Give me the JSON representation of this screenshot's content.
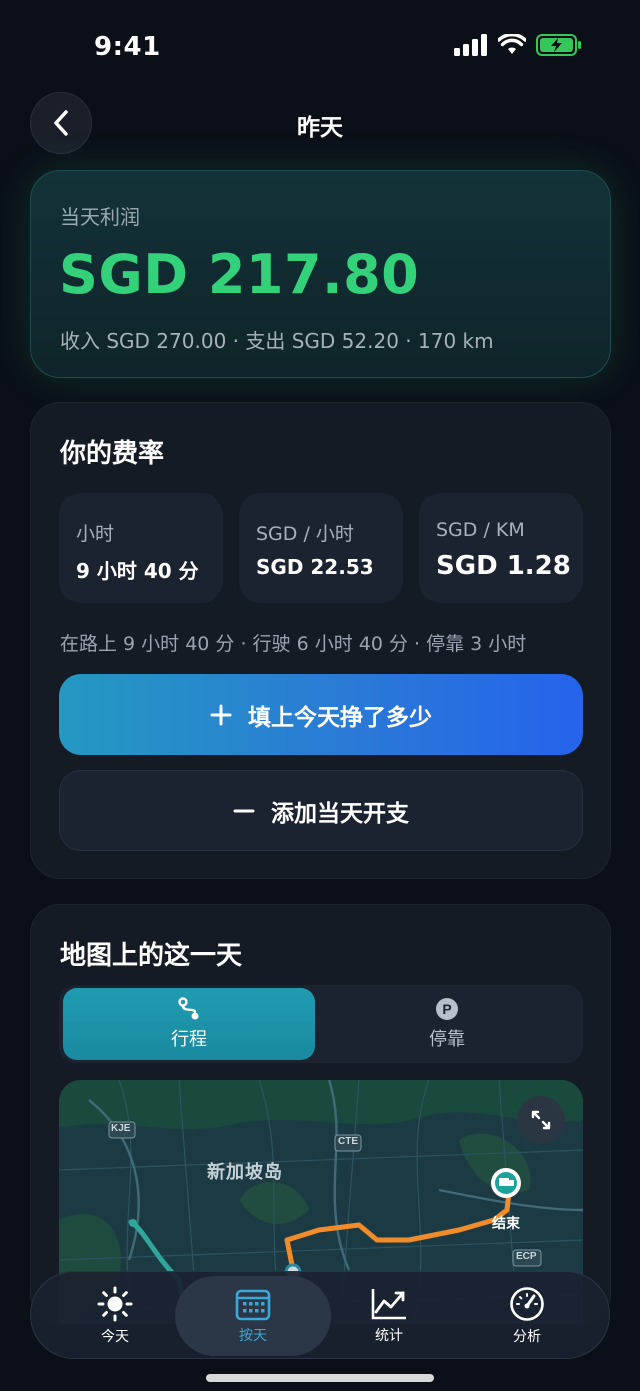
{
  "status": {
    "time": "9:41"
  },
  "nav": {
    "title": "昨天"
  },
  "profit": {
    "label": "当天利润",
    "value": "SGD 217.80",
    "summary": "收入 SGD 270.00 · 支出 SGD 52.20 · 170 km",
    "color": "#33d17a"
  },
  "rates": {
    "title": "你的费率",
    "items": [
      {
        "label": "小时",
        "value": "9 小时 40 分"
      },
      {
        "label": "SGD / 小时",
        "value": "SGD 22.53"
      },
      {
        "label": "SGD / KM",
        "value": "SGD 1.28"
      }
    ],
    "note": "在路上 9 小时 40 分 · 行驶 6 小时 40 分 · 停靠 3 小时",
    "fill_button": "填上今天挣了多少",
    "expense_button": "添加当天开支"
  },
  "map_section": {
    "title": "地图上的这一天",
    "tabs": [
      {
        "label": "行程",
        "icon": "route-icon",
        "active": true
      },
      {
        "label": "停靠",
        "icon": "parking-icon",
        "active": false
      }
    ],
    "map": {
      "island_label": "新加坡岛",
      "road_labels": [
        "KJE",
        "CTE",
        "ECP"
      ],
      "end_label": "结束",
      "route_color": "#f28c2b"
    }
  },
  "tab_bar": {
    "items": [
      {
        "label": "今天",
        "icon": "sun-icon"
      },
      {
        "label": "按天",
        "icon": "calendar-icon",
        "active": true
      },
      {
        "label": "统计",
        "icon": "chart-icon"
      },
      {
        "label": "分析",
        "icon": "gauge-icon"
      }
    ]
  }
}
